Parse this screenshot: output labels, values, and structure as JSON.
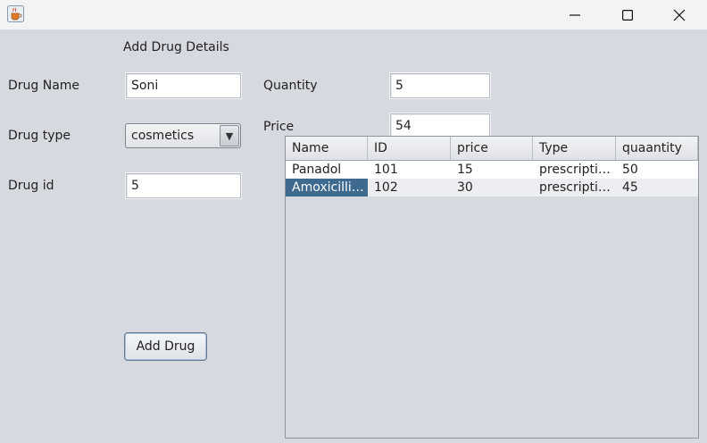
{
  "window": {
    "icon": "java-cup-icon",
    "controls": {
      "minimize": "minimize-icon",
      "maximize": "maximize-icon",
      "close": "close-icon"
    }
  },
  "form": {
    "heading": "Add Drug Details",
    "drug_name_label": "Drug Name",
    "drug_name_value": "Soni",
    "drug_type_label": "Drug type",
    "drug_type_selected": "cosmetics",
    "drug_id_label": "Drug id",
    "drug_id_value": "5",
    "quantity_label": "Quantity",
    "quantity_value": "5",
    "price_label": "Price",
    "price_value": "54",
    "add_button_label": "Add Drug"
  },
  "table": {
    "columns": [
      "Name",
      "ID",
      "price",
      "Type",
      "quaantity"
    ],
    "rows": [
      [
        "Panadol",
        "101",
        "15",
        "prescriptio...",
        "50"
      ],
      [
        "Amoxicillin ...",
        "102",
        "30",
        "prescriptio...",
        "45"
      ]
    ]
  },
  "colors": {
    "background": "#d6d9df",
    "selection": "#3d6a8e",
    "titlebar": "#f3f3f3"
  }
}
